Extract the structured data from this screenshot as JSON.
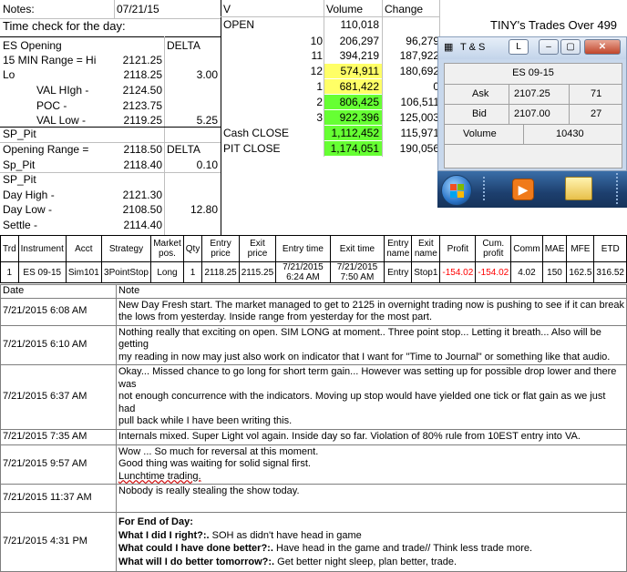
{
  "notes": {
    "label": "Notes:",
    "date": "07/21/15",
    "time_check": "Time check for the day:",
    "rows": [
      {
        "label": "ES Opening",
        "value": "",
        "tag": "DELTA",
        "delta": ""
      },
      {
        "label": "15 MIN Range = Hi",
        "value": "2121.25",
        "tag": "",
        "delta": ""
      },
      {
        "label": "Lo",
        "value": "2118.25",
        "tag": "",
        "delta": "3.00"
      },
      {
        "label": "VAL HIgh -",
        "value": "2124.50",
        "tag": "",
        "delta": ""
      },
      {
        "label": "POC -",
        "value": "2123.75",
        "tag": "",
        "delta": ""
      },
      {
        "label": "VAL Low -",
        "value": "2119.25",
        "tag": "",
        "delta": "5.25"
      },
      {
        "label": "SP_Pit",
        "value": "",
        "tag": "",
        "delta": ""
      },
      {
        "label": "Opening Range =",
        "value": "2118.50",
        "tag": "DELTA",
        "delta": ""
      },
      {
        "label": "Sp_Pit",
        "value": "2118.40",
        "tag": "",
        "delta": "0.10"
      },
      {
        "label": "SP_Pit",
        "value": "",
        "tag": "",
        "delta": ""
      },
      {
        "label": "Day High -",
        "value": "2121.30",
        "tag": "",
        "delta": ""
      },
      {
        "label": "Day Low -",
        "value": "2108.50",
        "tag": "",
        "delta": "12.80"
      },
      {
        "label": "Settle -",
        "value": "2114.40",
        "tag": "",
        "delta": ""
      }
    ]
  },
  "volume": {
    "headers": [
      "V",
      "Volume",
      "Change"
    ],
    "rows": [
      {
        "label": "OPEN",
        "volume": "110,018",
        "change": "",
        "hl": ""
      },
      {
        "label": "10",
        "volume": "206,297",
        "change": "96,279",
        "hl": ""
      },
      {
        "label": "11",
        "volume": "394,219",
        "change": "187,922",
        "hl": ""
      },
      {
        "label": "12",
        "volume": "574,911",
        "change": "180,692",
        "hl": "yellow"
      },
      {
        "label": "1",
        "volume": "681,422",
        "change": "0",
        "hl": "yellow"
      },
      {
        "label": "2",
        "volume": "806,425",
        "change": "106,511",
        "hl": "green"
      },
      {
        "label": "3",
        "volume": "922,396",
        "change": "125,003",
        "hl": "green"
      },
      {
        "label": "Cash CLOSE",
        "volume": "1,112,452",
        "change": "115,971",
        "hl": "green"
      },
      {
        "label": "PIT CLOSE",
        "volume": "1,174,051",
        "change": "190,056",
        "hl": "green"
      }
    ]
  },
  "tiny_title": "TINY's Trades Over 499",
  "ts_window": {
    "title": "T & S",
    "instrument": "ES 09-15",
    "ask_label": "Ask",
    "ask_price": "2107.25",
    "ask_size": "71",
    "bid_label": "Bid",
    "bid_price": "2107.00",
    "bid_size": "27",
    "volume_label": "Volume",
    "volume_value": "10430"
  },
  "trades": {
    "headers": [
      "Trd",
      "Instrument",
      "Acct",
      "Strategy",
      "Market pos.",
      "Qty",
      "Entry price",
      "Exit price",
      "Entry time",
      "Exit time",
      "Entry name",
      "Exit name",
      "Profit",
      "Cum. profit",
      "Comm",
      "MAE",
      "MFE",
      "ETD"
    ],
    "row": [
      "1",
      "ES 09-15",
      "Sim101",
      "3PointStop",
      "Long",
      "1",
      "2118.25",
      "2115.25",
      "7/21/2015 6:24 AM",
      "7/21/2015 7:50 AM",
      "Entry",
      "Stop1",
      "-154.02",
      "-154.02",
      "4.02",
      "150",
      "162.5",
      "316.52"
    ]
  },
  "journal": {
    "headers": [
      "Date",
      "Note"
    ],
    "rows": [
      {
        "date": "7/21/2015 6:08 AM",
        "lines": [
          "New Day Fresh start.  The market managed to get to 2125 in overnight trading now is pushing to see if it can break",
          "the lows from yesterday.  Inside range from yesterday for the most part."
        ]
      },
      {
        "date": "7/21/2015 6:10 AM",
        "lines": [
          "Nothing really that exciting on open.  SIM LONG at moment.. Three point stop... Letting it breath... Also will be getting",
          "my reading in now may just also work on indicator that I want for \"Time to Journal\" or something like that audio."
        ]
      },
      {
        "date": "7/21/2015 6:37 AM",
        "lines": [
          "Okay... Missed chance to go long for short term gain... However was setting up for possible drop lower and there was",
          "not enough concurrence with the indicators.  Moving up stop would have yielded one tick or flat gain as we just had",
          "pull back while I have been writing this."
        ]
      },
      {
        "date": "7/21/2015 7:35 AM",
        "lines": [
          "Internals mixed.  Super Light vol again.  Inside day so far.  Violation of 80% rule from 10EST entry into VA."
        ]
      },
      {
        "date": "7/21/2015 9:57 AM",
        "lines": [
          "Wow ... So much for reversal at this moment.",
          "Good thing was waiting for solid signal first.",
          "Lunchtime trading."
        ]
      },
      {
        "date": "7/21/2015 11:37 AM",
        "lines": [
          "Nobody is really stealing the show today."
        ]
      }
    ],
    "last": {
      "date": "7/21/2015 4:31 PM",
      "heading": "For End of Day:",
      "q1": "What I did I right?:.",
      "a1": "  SOH as didn't have head in game",
      "q2": "What could I have done better?:.",
      "a2": "  Have head in the game and trade// Think less trade more.",
      "q3": "What will I do better tomorrow?:.",
      "a3": "  Get better night sleep, plan better, trade."
    }
  }
}
